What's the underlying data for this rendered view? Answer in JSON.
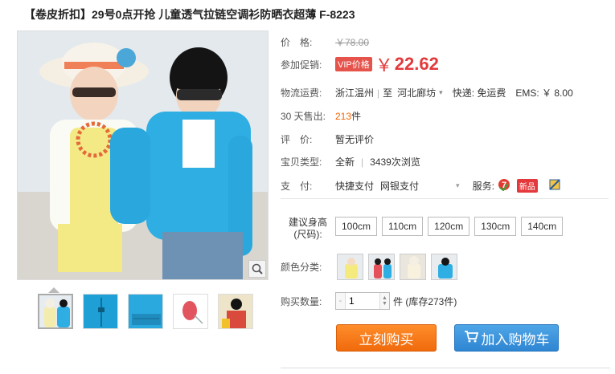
{
  "title": "【卷皮折扣】29号0点开抢 儿童透气拉链空调衫防晒衣超薄 F-8223",
  "price": {
    "label": "价　格:",
    "original": "￥78.00"
  },
  "promo": {
    "label": "参加促销:",
    "badge": "VIP价格",
    "yen": "￥",
    "price": "22.62"
  },
  "shipping": {
    "label": "物流运费:",
    "from": "浙江温州",
    "separator": "至",
    "to": "河北廊坊",
    "express": "快递: 免运费",
    "ems": "EMS: ￥ 8.00"
  },
  "sales": {
    "label": "30 天售出:",
    "count": "213",
    "unit": "件"
  },
  "review": {
    "label": "评　价:",
    "value": "暂无评价"
  },
  "condition": {
    "label": "宝贝类型:",
    "value": "全新",
    "views": "3439次浏览"
  },
  "payment": {
    "label": "支　付:",
    "method1": "快捷支付",
    "method2": "网银支付",
    "service_label": "服务:",
    "new_badge": "新品"
  },
  "size": {
    "label_line1": "建议身高",
    "label_line2": "(尺码):",
    "options": [
      "100cm",
      "110cm",
      "120cm",
      "130cm",
      "140cm"
    ]
  },
  "color": {
    "label": "颜色分类:"
  },
  "quantity": {
    "label": "购买数量:",
    "value": "1",
    "stock": "件 (库存273件)"
  },
  "actions": {
    "buy": "立刻购买",
    "cart": "加入购物车"
  }
}
